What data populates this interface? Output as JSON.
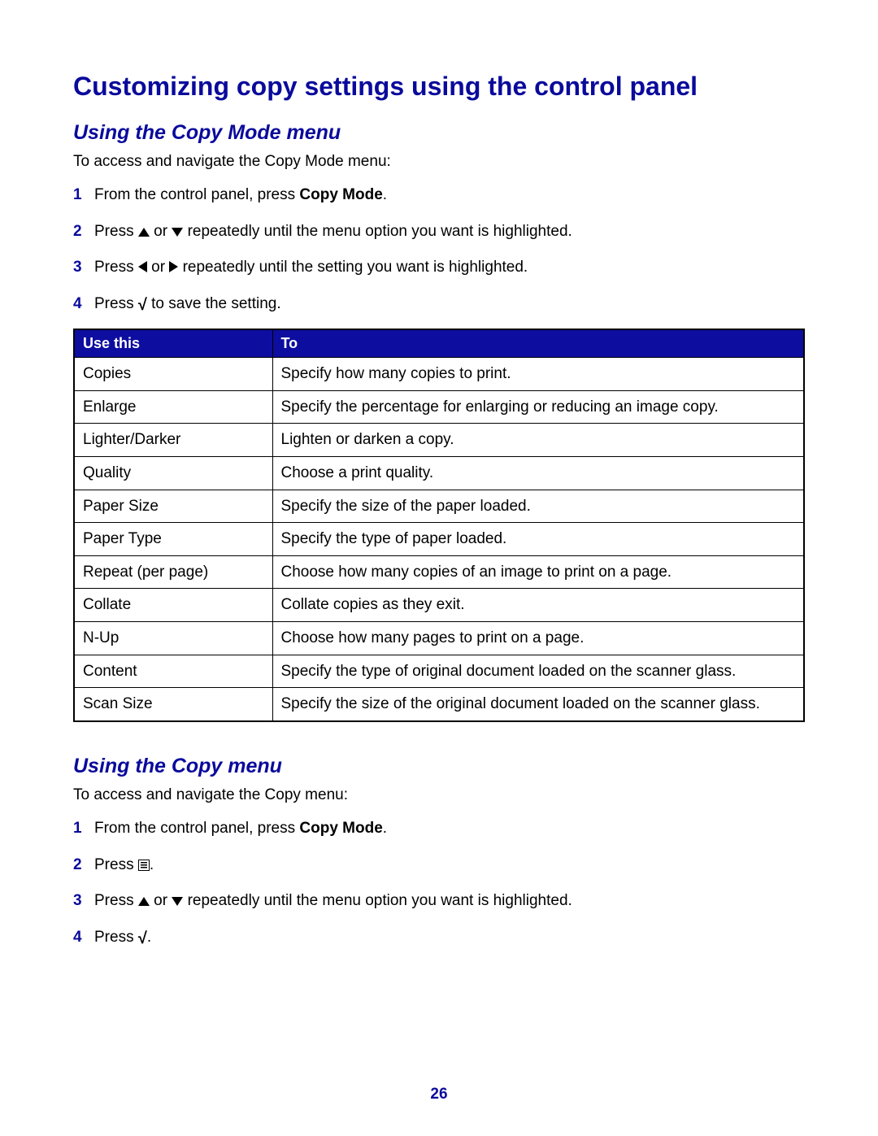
{
  "title": "Customizing copy settings using the control panel",
  "page_number": "26",
  "section1": {
    "heading": "Using the Copy Mode menu",
    "intro": "To access and navigate the Copy Mode menu:",
    "step1_a": "From the control panel, press ",
    "step1_bold": "Copy Mode",
    "step1_c": ".",
    "step2_a": "Press ",
    "step2_b": " or ",
    "step2_c": " repeatedly until the menu option you want is highlighted.",
    "step3_a": "Press ",
    "step3_b": " or ",
    "step3_c": " repeatedly until the setting you want is highlighted.",
    "step4_a": "Press ",
    "step4_b": " to save the setting."
  },
  "table": {
    "headers": {
      "col1": "Use this",
      "col2": "To"
    },
    "rows": [
      {
        "use": "Copies",
        "to": "Specify how many copies to print."
      },
      {
        "use": "Enlarge",
        "to": "Specify the percentage for enlarging or reducing an image copy."
      },
      {
        "use": "Lighter/Darker",
        "to": "Lighten or darken a copy."
      },
      {
        "use": "Quality",
        "to": "Choose a print quality."
      },
      {
        "use": "Paper Size",
        "to": "Specify the size of the paper loaded."
      },
      {
        "use": "Paper Type",
        "to": "Specify the type of paper loaded."
      },
      {
        "use": "Repeat (per page)",
        "to": "Choose how many copies of an image to print on a page."
      },
      {
        "use": "Collate",
        "to": "Collate copies as they exit."
      },
      {
        "use": "N-Up",
        "to": "Choose how many pages to print on a page."
      },
      {
        "use": "Content",
        "to": "Specify the type of original document loaded on the scanner glass."
      },
      {
        "use": "Scan Size",
        "to": "Specify the size of the original document loaded on the scanner glass."
      }
    ]
  },
  "section2": {
    "heading": "Using the Copy menu",
    "intro": "To access and navigate the Copy menu:",
    "step1_a": "From the control panel, press ",
    "step1_bold": "Copy Mode",
    "step1_c": ".",
    "step2_a": "Press ",
    "step2_b": ".",
    "step3_a": "Press ",
    "step3_b": " or ",
    "step3_c": " repeatedly until the menu option you want is highlighted.",
    "step4_a": "Press ",
    "step4_b": "."
  }
}
